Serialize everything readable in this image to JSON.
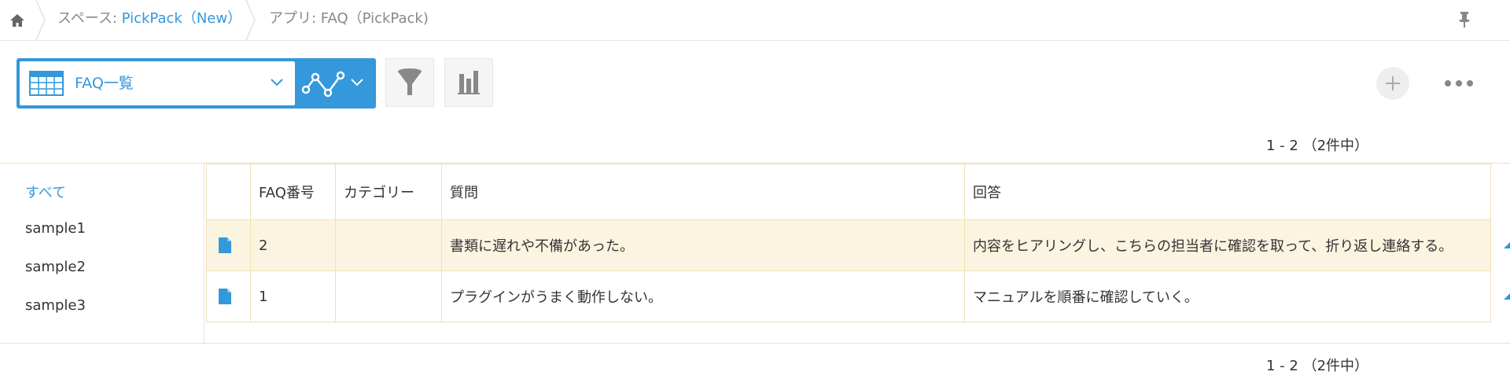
{
  "breadcrumb": {
    "space_prefix": "スペース: ",
    "space_name": "PickPack（New）",
    "app_label": "アプリ: FAQ（PickPack)"
  },
  "icons": {
    "home": "home-icon",
    "pin": "pin-icon",
    "view_table": "table-view-icon",
    "graph": "graph-icon",
    "filter": "filter-icon",
    "chart": "bar-chart-icon",
    "add": "plus-icon",
    "more": "more-icon",
    "record": "document-icon"
  },
  "toolbar": {
    "view_name": "FAQ一覧"
  },
  "pager": {
    "top_text": "1 - 2 （2件中）",
    "bottom_text": "1 - 2 （2件中）"
  },
  "categories": {
    "items": [
      "すべて",
      "sample1",
      "sample2",
      "sample3"
    ],
    "active": "すべて"
  },
  "table": {
    "columns": [
      "FAQ番号",
      "カテゴリー",
      "質問",
      "回答"
    ],
    "rows": [
      {
        "faq_no": "2",
        "category": "",
        "question": "書類に遅れや不備があった。",
        "answer": "内容をヒアリングし、こちらの担当者に確認を取って、折り返し連絡する。"
      },
      {
        "faq_no": "1",
        "category": "",
        "question": "プラグインがうまく動作しない。",
        "answer": "マニュアルを順番に確認していく。"
      }
    ]
  },
  "colors": {
    "accent": "#3498db",
    "row_highlight": "#fbf4e0",
    "grid_border": "#f0e2b6",
    "muted_text": "#888888"
  }
}
